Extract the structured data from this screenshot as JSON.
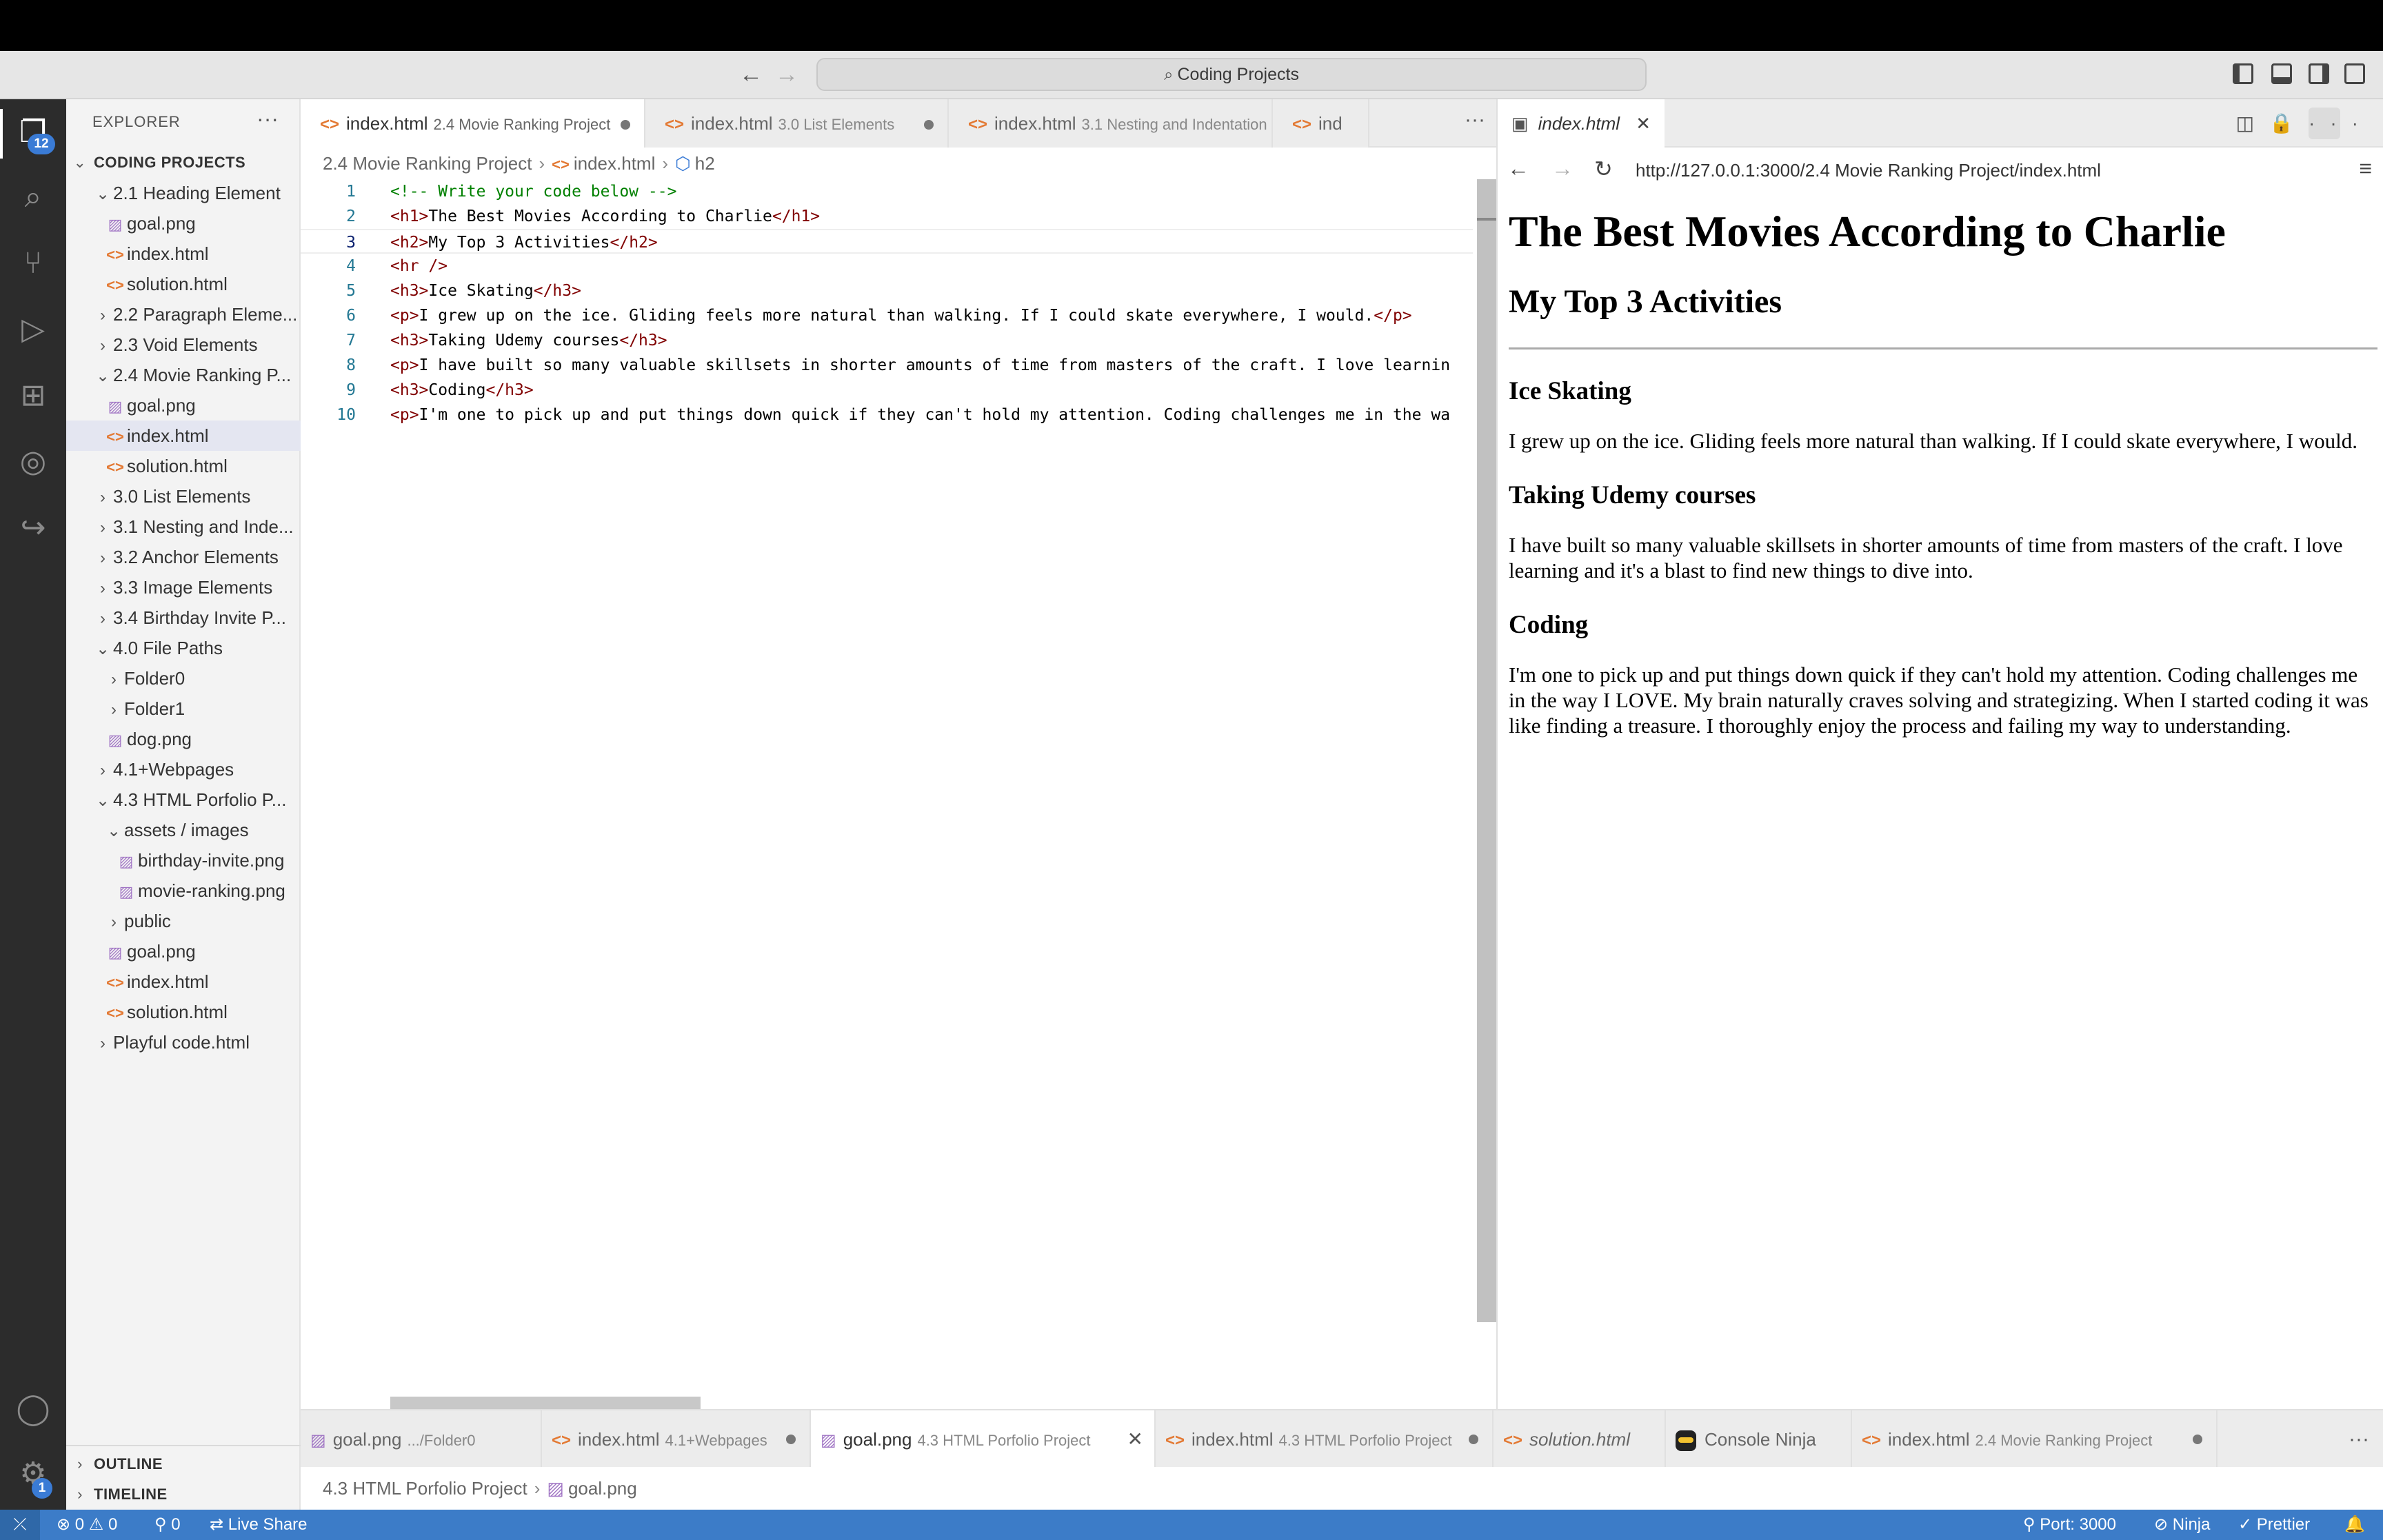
{
  "titlebar": {
    "search_label": "Coding Projects"
  },
  "activity": {
    "explorer_badge": "12",
    "accounts_badge": "1"
  },
  "sidebar": {
    "header": "EXPLORER",
    "root": "CODING PROJECTS",
    "items": [
      {
        "label": "2.1 Heading Element",
        "kind": "folder-open",
        "depth": 1
      },
      {
        "label": "goal.png",
        "kind": "png",
        "depth": 2
      },
      {
        "label": "index.html",
        "kind": "html",
        "depth": 2
      },
      {
        "label": "solution.html",
        "kind": "html",
        "depth": 2
      },
      {
        "label": "2.2 Paragraph Eleme...",
        "kind": "folder",
        "depth": 1
      },
      {
        "label": "2.3 Void Elements",
        "kind": "folder",
        "depth": 1
      },
      {
        "label": "2.4 Movie Ranking P...",
        "kind": "folder-open",
        "depth": 1
      },
      {
        "label": "goal.png",
        "kind": "png",
        "depth": 2
      },
      {
        "label": "index.html",
        "kind": "html",
        "depth": 2,
        "selected": true
      },
      {
        "label": "solution.html",
        "kind": "html",
        "depth": 2
      },
      {
        "label": "3.0 List Elements",
        "kind": "folder",
        "depth": 1
      },
      {
        "label": "3.1 Nesting and Inde...",
        "kind": "folder",
        "depth": 1
      },
      {
        "label": "3.2 Anchor Elements",
        "kind": "folder",
        "depth": 1
      },
      {
        "label": "3.3 Image Elements",
        "kind": "folder",
        "depth": 1
      },
      {
        "label": "3.4 Birthday Invite P...",
        "kind": "folder",
        "depth": 1
      },
      {
        "label": "4.0 File Paths",
        "kind": "folder-open",
        "depth": 1
      },
      {
        "label": "Folder0",
        "kind": "folder",
        "depth": 2
      },
      {
        "label": "Folder1",
        "kind": "folder",
        "depth": 2
      },
      {
        "label": "dog.png",
        "kind": "png",
        "depth": 2
      },
      {
        "label": "4.1+Webpages",
        "kind": "folder",
        "depth": 1
      },
      {
        "label": "4.3 HTML Porfolio P...",
        "kind": "folder-open",
        "depth": 1
      },
      {
        "label": "assets / images",
        "kind": "folder-open",
        "depth": 2
      },
      {
        "label": "birthday-invite.png",
        "kind": "png",
        "depth": 3
      },
      {
        "label": "movie-ranking.png",
        "kind": "png",
        "depth": 3
      },
      {
        "label": "public",
        "kind": "folder",
        "depth": 2
      },
      {
        "label": "goal.png",
        "kind": "png",
        "depth": 2
      },
      {
        "label": "index.html",
        "kind": "html",
        "depth": 2
      },
      {
        "label": "solution.html",
        "kind": "html",
        "depth": 2
      },
      {
        "label": "Playful code.html",
        "kind": "folder",
        "depth": 1
      }
    ],
    "outline": "OUTLINE",
    "timeline": "TIMELINE"
  },
  "editor": {
    "tabs": [
      {
        "name": "index.html",
        "desc": "2.4 Movie Ranking Project",
        "active": true,
        "dirty": true
      },
      {
        "name": "index.html",
        "desc": "3.0 List Elements",
        "active": false,
        "dirty": true
      },
      {
        "name": "index.html",
        "desc": "3.1 Nesting and Indentation",
        "active": false,
        "dirty": false
      },
      {
        "name": "ind",
        "desc": "",
        "active": false,
        "dirty": false
      }
    ],
    "breadcrumb": {
      "folder": "2.4 Movie Ranking Project",
      "file": "index.html",
      "symbol": "h2"
    },
    "lines": [
      {
        "n": "1",
        "segments": [
          {
            "t": "comment",
            "v": "<!-- Write your code below -->"
          }
        ]
      },
      {
        "n": "2",
        "segments": [
          {
            "t": "tag",
            "v": "<h1>"
          },
          {
            "t": "text",
            "v": "The Best Movies According to Charlie"
          },
          {
            "t": "tag",
            "v": "</h1>"
          }
        ]
      },
      {
        "n": "3",
        "segments": [
          {
            "t": "tag",
            "v": "<h2>"
          },
          {
            "t": "text",
            "v": "My Top 3 Activities"
          },
          {
            "t": "tag",
            "v": "</h2>"
          }
        ],
        "current": true
      },
      {
        "n": "4",
        "segments": [
          {
            "t": "tag",
            "v": "<hr />"
          }
        ]
      },
      {
        "n": "5",
        "segments": [
          {
            "t": "tag",
            "v": "<h3>"
          },
          {
            "t": "text",
            "v": "Ice Skating"
          },
          {
            "t": "tag",
            "v": "</h3>"
          }
        ]
      },
      {
        "n": "6",
        "segments": [
          {
            "t": "tag",
            "v": "<p>"
          },
          {
            "t": "text",
            "v": "I grew up on the ice. Gliding feels more natural than walking. If I could skate everywhere, I would."
          },
          {
            "t": "tag",
            "v": "</p>"
          }
        ]
      },
      {
        "n": "7",
        "segments": [
          {
            "t": "tag",
            "v": "<h3>"
          },
          {
            "t": "text",
            "v": "Taking Udemy courses"
          },
          {
            "t": "tag",
            "v": "</h3>"
          }
        ]
      },
      {
        "n": "8",
        "segments": [
          {
            "t": "tag",
            "v": "<p>"
          },
          {
            "t": "text",
            "v": "I have built so many valuable skillsets in shorter amounts of time from masters of the craft. I love learnin"
          }
        ]
      },
      {
        "n": "9",
        "segments": [
          {
            "t": "tag",
            "v": "<h3>"
          },
          {
            "t": "text",
            "v": "Coding"
          },
          {
            "t": "tag",
            "v": "</h3>"
          }
        ]
      },
      {
        "n": "10",
        "segments": [
          {
            "t": "tag",
            "v": "<p>"
          },
          {
            "t": "text",
            "v": "I'm one to pick up and put things down quick if they can't hold my attention. Coding challenges me in the wa"
          }
        ]
      }
    ]
  },
  "preview": {
    "tab_label": "index.html",
    "url": "http://127.0.0.1:3000/2.4 Movie Ranking Project/index.html",
    "h1": "The Best Movies According to Charlie",
    "h2": "My Top 3 Activities",
    "sections": [
      {
        "h3": "Ice Skating",
        "p": "I grew up on the ice. Gliding feels more natural than walking. If I could skate everywhere, I would."
      },
      {
        "h3": "Taking Udemy courses",
        "p": "I have built so many valuable skillsets in shorter amounts of time from masters of the craft. I love learning and it's a blast to find new things to dive into."
      },
      {
        "h3": "Coding",
        "p": "I'm one to pick up and put things down quick if they can't hold my attention. Coding challenges me in the way I LOVE. My brain naturally craves solving and strategizing. When I started coding it was like finding a treasure. I thoroughly enjoy the process and failing my way to understanding."
      }
    ]
  },
  "bottom_tabs": [
    {
      "name": "goal.png",
      "desc": ".../Folder0",
      "icon": "png",
      "active": false,
      "dirty": false
    },
    {
      "name": "index.html",
      "desc": "4.1+Webpages",
      "icon": "html",
      "active": false,
      "dirty": true
    },
    {
      "name": "goal.png",
      "desc": "4.3 HTML Porfolio Project",
      "icon": "png",
      "active": true,
      "dirty": false
    },
    {
      "name": "index.html",
      "desc": "4.3 HTML Porfolio Project",
      "icon": "html",
      "active": false,
      "dirty": true
    },
    {
      "name": "solution.html",
      "desc": "",
      "icon": "html",
      "active": false,
      "dirty": false
    },
    {
      "name": "Console Ninja",
      "desc": "",
      "icon": "ninja",
      "active": false,
      "dirty": false
    },
    {
      "name": "index.html",
      "desc": "2.4 Movie Ranking Project",
      "icon": "html",
      "active": false,
      "dirty": true
    }
  ],
  "bottom_breadcrumb": {
    "folder": "4.3 HTML Porfolio Project",
    "file": "goal.png"
  },
  "status": {
    "errors": "0",
    "warnings": "0",
    "ports": "0",
    "live_share": "Live Share",
    "port_label": "Port: 3000",
    "ninja": "Ninja",
    "prettier": "Prettier"
  },
  "colors": {
    "statusbar": "#3c7cc8",
    "activitybar": "#2c2c2c",
    "sidebar": "#f3f3f3",
    "selection": "#e4e6f1"
  }
}
